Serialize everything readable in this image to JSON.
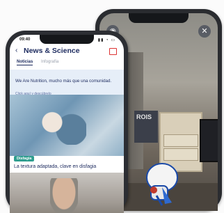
{
  "front_app": {
    "status_time": "09:40",
    "status_icons": "▮▮ ◔ ▭",
    "title": "News & Science",
    "tabs": [
      {
        "label": "Noticias",
        "active": true
      },
      {
        "label": "Infografía",
        "active": false
      }
    ],
    "banner": {
      "text": "We Are Nutrition, mucho más que una comunidad.",
      "link": "Click aquí y descúbrelo"
    },
    "badge": "Disfagia",
    "headline": "La textura adaptada, clave en disfagia"
  },
  "back_app": {
    "poster_text": "ROIS"
  },
  "colors": {
    "brand": "#1c2a5e",
    "badge": "#2f9e8f",
    "banner_bg": "#e6eef8"
  }
}
